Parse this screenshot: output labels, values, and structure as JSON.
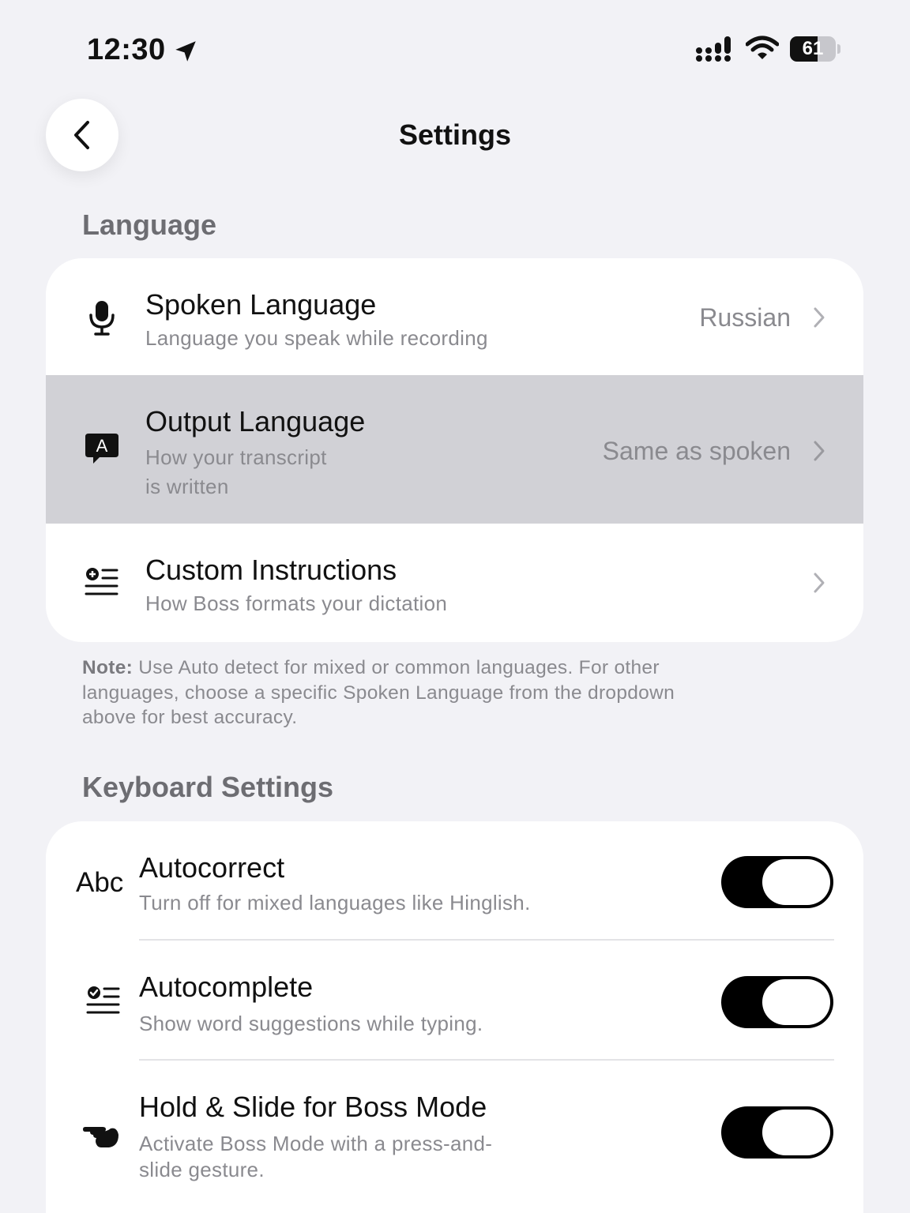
{
  "status_bar": {
    "time": "12:30",
    "battery": "61",
    "battery_level": 0.61
  },
  "header": {
    "title": "Settings"
  },
  "language_section": {
    "title": "Language",
    "rows": [
      {
        "title": "Spoken Language",
        "subtitle": "Language you speak while recording",
        "value": "Russian",
        "icon": "microphone-icon"
      },
      {
        "title": "Output Language",
        "subtitle_line1": "How your transcript",
        "subtitle_line2": "is written",
        "value": "Same as spoken",
        "icon": "speech-bubble-a-icon"
      },
      {
        "title": "Custom Instructions",
        "subtitle": "How Boss formats your dictation",
        "icon": "list-plus-icon"
      }
    ],
    "note_label": "Note:",
    "note_text": " Use Auto detect for mixed or common languages. For other languages, choose a specific Spoken Language from the dropdown above for best accuracy."
  },
  "keyboard_section": {
    "title": "Keyboard Settings",
    "rows": [
      {
        "icon_text": "Abc",
        "title": "Autocorrect",
        "subtitle": "Turn off for mixed languages like Hinglish.",
        "enabled": true
      },
      {
        "icon": "list-check-icon",
        "title": "Autocomplete",
        "subtitle": "Show word suggestions while typing.",
        "enabled": true
      },
      {
        "icon": "pointing-hand-icon",
        "title": "Hold & Slide for Boss Mode",
        "subtitle_line1": "Activate Boss Mode with a press-and-",
        "subtitle_line2": "slide gesture.",
        "enabled": true
      }
    ]
  },
  "colors": {
    "background": "#f2f2f6",
    "card": "#ffffff",
    "highlight": "#d1d1d6",
    "secondary_text": "#8a8a8f",
    "toggle_on": "#000000"
  }
}
